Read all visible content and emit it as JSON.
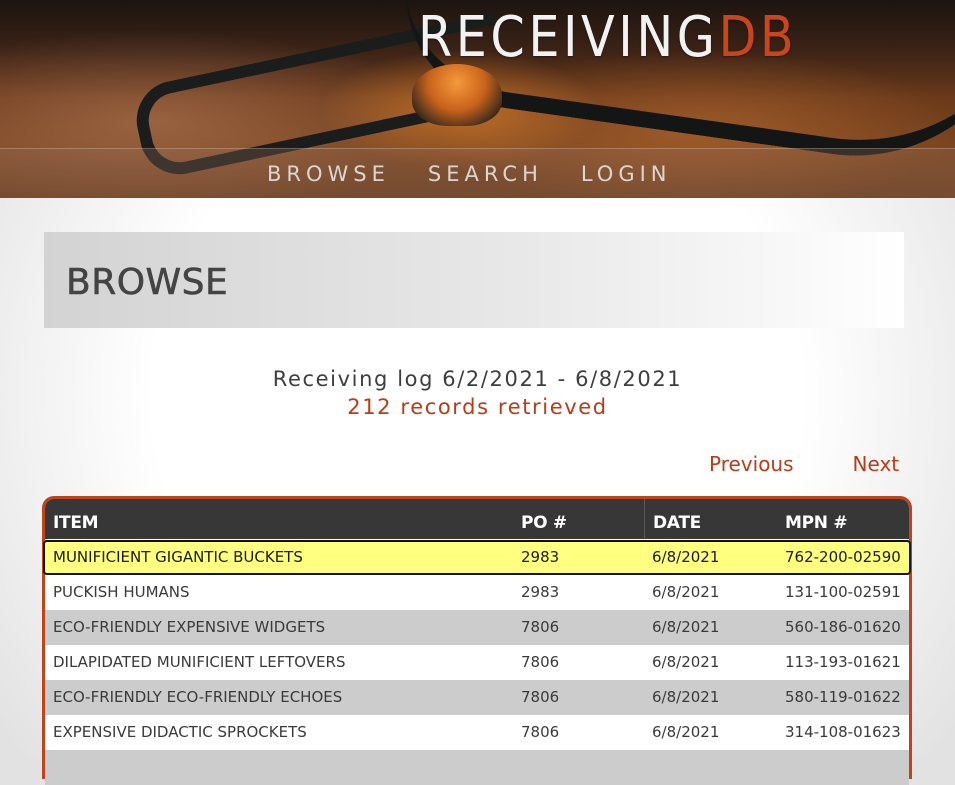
{
  "header": {
    "logo_main": "RECEIVING",
    "logo_accent": "DB",
    "nav": [
      {
        "label": "BROWSE"
      },
      {
        "label": "SEARCH"
      },
      {
        "label": "LOGIN"
      }
    ]
  },
  "page": {
    "title": "BROWSE",
    "range_text": "Receiving log 6/2/2021 - 6/8/2021",
    "count_text": "212 records retrieved"
  },
  "pager": {
    "previous_label": "Previous",
    "next_label": "Next"
  },
  "table": {
    "columns": [
      "ITEM",
      "PO #",
      "DATE",
      "MPN #"
    ],
    "rows": [
      {
        "item": "MUNIFICIENT GIGANTIC BUCKETS",
        "po": "2983",
        "date": "6/8/2021",
        "mpn": "762-200-02590",
        "selected": true
      },
      {
        "item": "PUCKISH HUMANS",
        "po": "2983",
        "date": "6/8/2021",
        "mpn": "131-100-02591"
      },
      {
        "item": "ECO-FRIENDLY EXPENSIVE WIDGETS",
        "po": "7806",
        "date": "6/8/2021",
        "mpn": "560-186-01620"
      },
      {
        "item": "DILAPIDATED MUNIFICIENT LEFTOVERS",
        "po": "7806",
        "date": "6/8/2021",
        "mpn": "113-193-01621"
      },
      {
        "item": "ECO-FRIENDLY ECO-FRIENDLY ECHOES",
        "po": "7806",
        "date": "6/8/2021",
        "mpn": "580-119-01622"
      },
      {
        "item": "EXPENSIVE DIDACTIC SPROCKETS",
        "po": "7806",
        "date": "6/8/2021",
        "mpn": "314-108-01623"
      },
      {
        "item": "",
        "po": "",
        "date": "",
        "mpn": ""
      }
    ]
  },
  "colors": {
    "accent": "#c8461c",
    "link": "#b83c18",
    "table_header": "#373737",
    "row_alt": "#cccccc",
    "row_selected": "#ffff80"
  }
}
